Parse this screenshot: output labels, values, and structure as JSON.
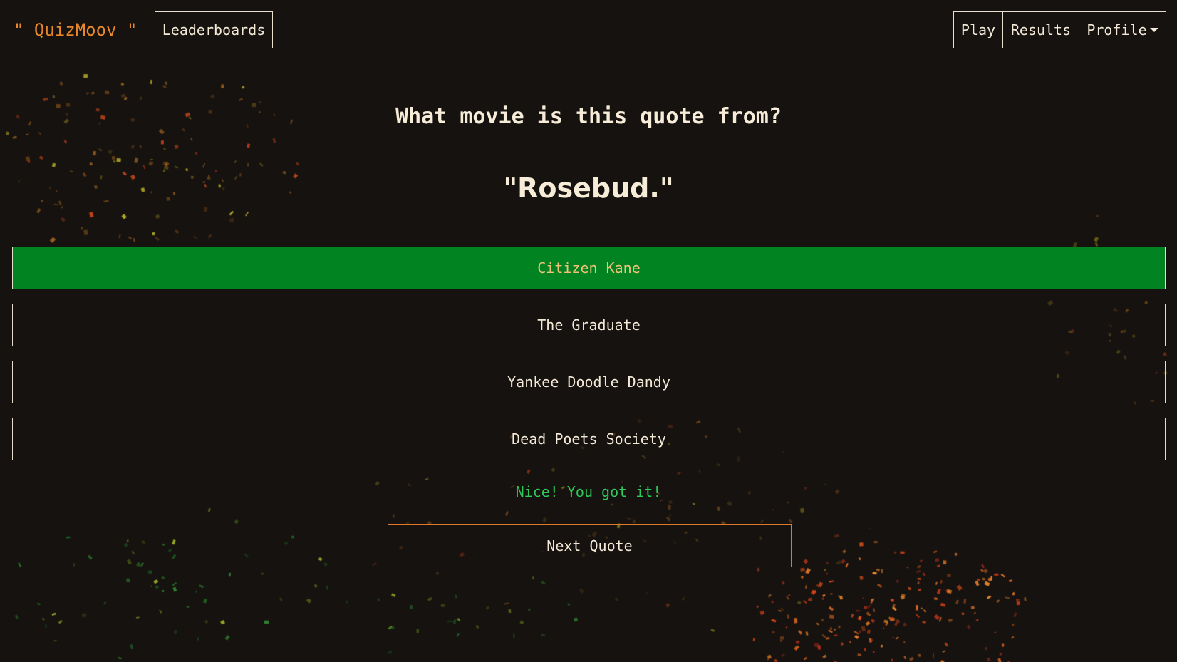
{
  "app": {
    "brand": "\" QuizMoov \""
  },
  "nav": {
    "leaderboards": "Leaderboards",
    "play": "Play",
    "results": "Results",
    "profile": "Profile"
  },
  "quiz": {
    "question": "What movie is this quote from?",
    "quote": "\"Rosebud.\"",
    "answers": [
      {
        "label": "Citizen Kane",
        "state": "correct"
      },
      {
        "label": "The Graduate",
        "state": "default"
      },
      {
        "label": "Yankee Doodle Dandy",
        "state": "default"
      },
      {
        "label": "Dead Poets Society",
        "state": "default"
      }
    ],
    "feedback": "Nice! You got it!",
    "next_label": "Next Quote"
  },
  "colors": {
    "background": "#161210",
    "accent": "#e8882a",
    "correct": "#028322",
    "feedback": "#2fc85a",
    "text": "#f4ead8"
  }
}
